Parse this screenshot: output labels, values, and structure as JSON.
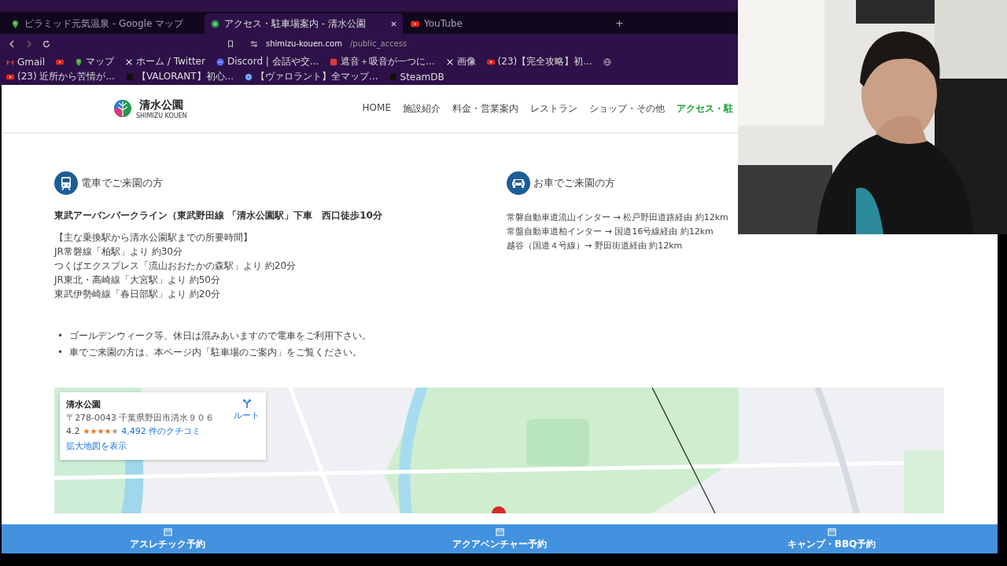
{
  "browser": {
    "tabs": [
      {
        "title": "ピラミッド元気温泉 - Google マップ",
        "kind": "maps",
        "selected": false
      },
      {
        "title": "アクセス・駐車場案内 - 清水公園",
        "kind": "site",
        "selected": true
      },
      {
        "title": "YouTube",
        "kind": "youtube",
        "selected": false
      }
    ],
    "new_tab": "+",
    "address": {
      "host": "shimizu-kouen.com",
      "path": "/public_access"
    },
    "bookmarks": [
      {
        "label": "Gmail",
        "kind": "gmail"
      },
      {
        "kind": "youtube"
      },
      {
        "label": "マップ",
        "kind": "maps"
      },
      {
        "label": "ホーム / Twitter",
        "kind": "x"
      },
      {
        "label": "Discord | 会話や交...",
        "kind": "discord"
      },
      {
        "label": "遮音＋吸音が一つに...",
        "kind": "red"
      },
      {
        "label": "画像",
        "kind": "x"
      },
      {
        "label": "(23)【完全攻略】初...",
        "kind": "youtube"
      },
      {
        "kind": "globe"
      },
      {
        "label": "(23) 近所から苦情が...",
        "kind": "youtube"
      },
      {
        "label": "【VALORANT】初心...",
        "kind": "dark"
      },
      {
        "label": "【ヴァロラント】全マップ...",
        "kind": "help"
      },
      {
        "label": "SteamDB",
        "kind": "dark"
      }
    ]
  },
  "site": {
    "logo": {
      "name": "清水公園",
      "sub": "SHIMIZU KOUEN"
    },
    "nav": [
      {
        "label": "HOME",
        "selected": false
      },
      {
        "label": "施設紹介",
        "selected": false
      },
      {
        "label": "料金・営業案内",
        "selected": false
      },
      {
        "label": "レストラン",
        "selected": false
      },
      {
        "label": "ショップ・その他",
        "selected": false
      },
      {
        "label": "アクセス・駐",
        "selected": true
      }
    ],
    "train": {
      "title": "電車でご来園の方",
      "lead": "東武アーバンパークライン（東武野田線 「清水公園駅」下車　西口徒歩10分",
      "lines": [
        "【主な乗換駅から清水公園駅までの所要時間】",
        "JR常磐線「柏駅」より 約30分",
        "つくばエクスプレス「流山おおたかの森駅」より 約20分",
        "JR東北・高崎線「大宮駅」より 約50分",
        "東武伊勢崎線「春日部駅」より 約20分"
      ]
    },
    "car": {
      "title": "お車でご来園の方",
      "lines": [
        "常磐自動車道流山インター → 松戸野田道路経由 約12km",
        "常盤自動車道柏インター → 国道16号線経由 約12km",
        "越谷（国道４号線）→ 野田街道経由 約12km"
      ]
    },
    "notes": [
      {
        "marker": "•",
        "text": "ゴールデンウィーク等、休日は混みあいますので電車をご利用下さい。"
      },
      {
        "marker": "•",
        "text": "車でご来園の方は、本ページ内「駐車場のご案内」をご覧ください。"
      }
    ],
    "map_card": {
      "name": "清水公園",
      "address": "〒278-0043 千葉県野田市清水９０６",
      "rating": "4.2",
      "stars": 4,
      "reviews": "4,492 件のクチコミ",
      "route": "ルート",
      "larger_map": "拡大地図を表示"
    },
    "booking": [
      "アスレチック予約",
      "アクアベンチャー予約",
      "キャンプ・BBQ予約"
    ]
  }
}
